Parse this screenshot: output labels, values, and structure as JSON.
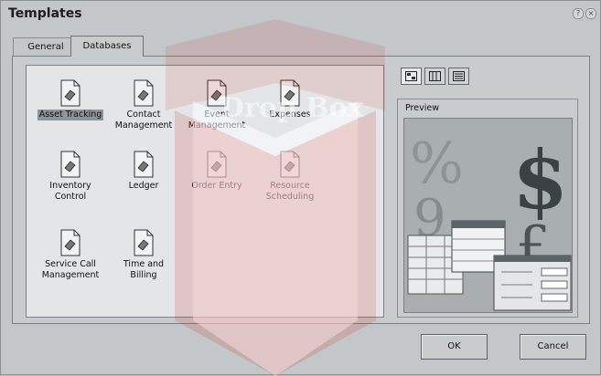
{
  "window": {
    "title": "Templates"
  },
  "tabs": [
    {
      "label": "General"
    },
    {
      "label": "Databases"
    }
  ],
  "templates": [
    {
      "label": "Asset Tracking",
      "selected": true
    },
    {
      "label": "Contact Management",
      "selected": false
    },
    {
      "label": "Event Management",
      "selected": false
    },
    {
      "label": "Expenses",
      "selected": false
    },
    {
      "label": "Inventory Control",
      "selected": false
    },
    {
      "label": "Ledger",
      "selected": false
    },
    {
      "label": "Order Entry",
      "selected": false
    },
    {
      "label": "Resource Scheduling",
      "selected": false
    },
    {
      "label": "Service Call Management",
      "selected": false
    },
    {
      "label": "Time and Billing",
      "selected": false
    }
  ],
  "view_buttons": [
    {
      "icon": "large-icons-view-icon",
      "active": true
    },
    {
      "icon": "list-view-icon",
      "active": false
    },
    {
      "icon": "details-view-icon",
      "active": false
    }
  ],
  "preview": {
    "label": "Preview"
  },
  "buttons": {
    "ok": "OK",
    "cancel": "Cancel"
  },
  "watermark": {
    "text": "Drop Box"
  },
  "colors": {
    "dialog_bg": "#c3c7c9",
    "selection": "#8d9597",
    "list_bg": "#e3e5e6"
  }
}
